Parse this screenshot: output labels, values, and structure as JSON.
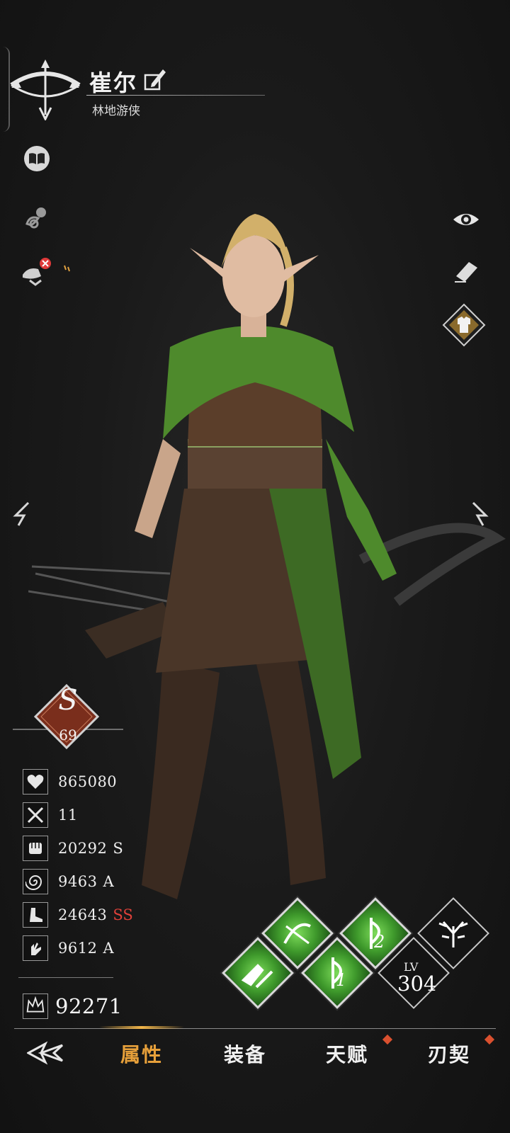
{
  "character": {
    "name": "崔尔",
    "class_name": "林地游侠",
    "class_icon": "bow-emblem-icon"
  },
  "left_icons": [
    {
      "name": "codex-book-icon"
    },
    {
      "name": "pet-icon"
    },
    {
      "name": "mount-disabled-icon"
    }
  ],
  "right_icons": [
    {
      "name": "eye-icon"
    },
    {
      "name": "eraser-icon"
    },
    {
      "name": "outfit-icon"
    }
  ],
  "rank": {
    "label": "S",
    "level": "69"
  },
  "stats": [
    {
      "icon": "heart-icon",
      "value": "865080",
      "grade": ""
    },
    {
      "icon": "crossed-swords-icon",
      "value": "11",
      "grade": ""
    },
    {
      "icon": "fist-icon",
      "value": "20292",
      "grade": "S"
    },
    {
      "icon": "spiral-icon",
      "value": "9463",
      "grade": "A"
    },
    {
      "icon": "boot-icon",
      "value": "24643",
      "grade": "SS"
    },
    {
      "icon": "hand-icon",
      "value": "9612",
      "grade": "A"
    }
  ],
  "combat_power": {
    "icon": "crown-icon",
    "value": "92271"
  },
  "skills": {
    "slot1": "arrow-rain-skill-icon",
    "slot2": "bow-skill-icon",
    "slot3": "bow-skill-2-icon",
    "slot4": "bow-skill-1-icon",
    "slot1_number": "",
    "slot3_number": "2",
    "slot4_number": "1"
  },
  "level": {
    "label": "LV",
    "value": "304"
  },
  "talent_tree_icon": "antler-tree-icon",
  "nav": {
    "back_icon": "back-emblem-icon",
    "tabs": [
      {
        "label": "属性",
        "active": true
      },
      {
        "label": "装备",
        "active": false
      },
      {
        "label": "天赋",
        "active": false,
        "badge": true
      },
      {
        "label": "刃契",
        "active": false,
        "badge": true
      }
    ]
  },
  "colors": {
    "active_tab": "#e7a03a",
    "grade_ss": "#e0413a",
    "skill_green": "#4fae36",
    "notify_dot": "#d9502f"
  }
}
